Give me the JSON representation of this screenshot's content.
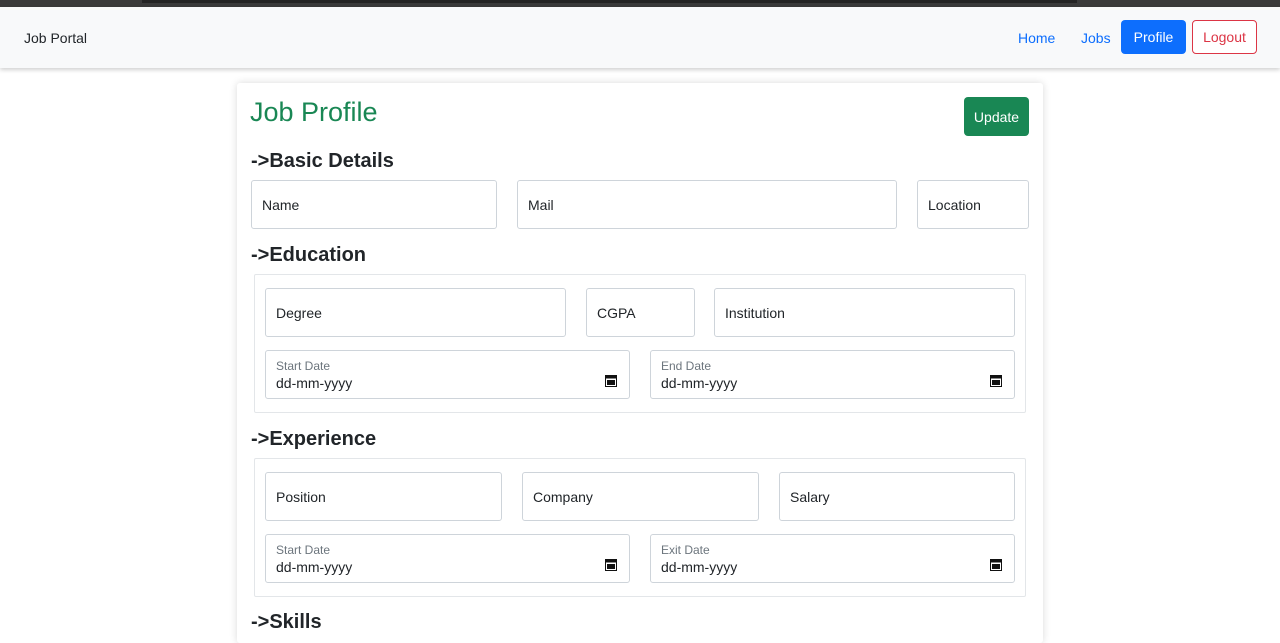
{
  "nav": {
    "brand": "Job Portal",
    "home": "Home",
    "jobs": "Jobs",
    "profile": "Profile",
    "logout": "Logout"
  },
  "page": {
    "title": "Job Profile",
    "update_label": "Update"
  },
  "basic": {
    "heading": "->Basic Details",
    "name_ph": "Name",
    "mail_ph": "Mail",
    "location_ph": "Location"
  },
  "education": {
    "heading": "->Education",
    "degree_ph": "Degree",
    "cgpa_ph": "CGPA",
    "institution_ph": "Institution",
    "start_label": "Start Date",
    "start_value": "dd-mm-yyyy",
    "end_label": "End Date",
    "end_value": "dd-mm-yyyy"
  },
  "experience": {
    "heading": "->Experience",
    "position_ph": "Position",
    "company_ph": "Company",
    "salary_ph": "Salary",
    "start_label": "Start Date",
    "start_value": "dd-mm-yyyy",
    "exit_label": "Exit Date",
    "exit_value": "dd-mm-yyyy"
  },
  "skills": {
    "heading": "->Skills"
  },
  "icons": {
    "calendar": "calendar-icon"
  },
  "colors": {
    "primary": "#0d6efd",
    "success": "#198754",
    "danger": "#dc3545"
  }
}
